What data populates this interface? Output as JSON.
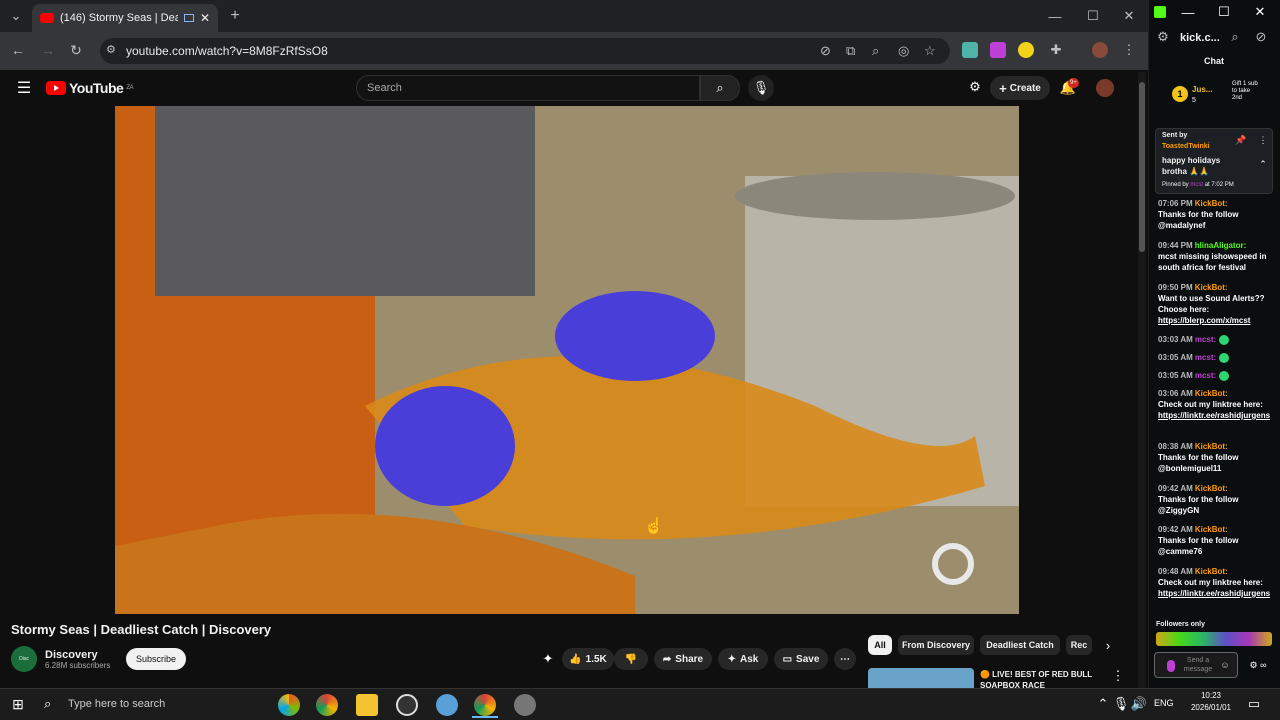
{
  "browser": {
    "tab_title": "(146) Stormy Seas | Deadlie",
    "url": "youtube.com/watch?v=8M8FzRfSsO8"
  },
  "youtube": {
    "logo": "YouTube",
    "country": "ZA",
    "search_placeholder": "Search",
    "create_label": "Create",
    "notif_count": "9+"
  },
  "video": {
    "title": "Stormy Seas | Deadliest Catch | Discovery",
    "channel": "Discovery",
    "subscribers": "6.28M subscribers",
    "subscribe": "Subscribe",
    "likes": "1.5K",
    "share": "Share",
    "ask": "Ask",
    "save": "Save"
  },
  "chips": [
    "All",
    "From Discovery",
    "Deadliest Catch",
    "Rec"
  ],
  "rec": {
    "title": "🟠 LIVE! BEST OF RED BULL SOAPBOX RACE"
  },
  "taskbar": {
    "search": "Type here to search",
    "lang": "ENG",
    "time": "10:23",
    "date": "2026/01/01"
  },
  "chat": {
    "tab_title": "kick.c...",
    "header": "Chat",
    "top_user": "Jus...",
    "top_count": "5",
    "gift_text": "Gift 1 sub to take 2nd",
    "pinned_sent_by": "Sent by",
    "pinned_user": "ToastedTwinki",
    "pinned_text": "happy holidays brotha 🙏🙏",
    "pinned_by": "Pinned by",
    "pinned_by_user": "mcst",
    "pinned_at": "at 7:02 PM",
    "followers_only": "Followers only",
    "send_placeholder": "Send a message",
    "messages": [
      {
        "t": "07:06 PM",
        "u": "KickBot:",
        "m": "Thanks for the follow @madalynef"
      },
      {
        "t": "09:44 PM",
        "u": "hlinaAligator:",
        "m": "mcst missing ishowspeed in south africa for festival"
      },
      {
        "t": "09:50 PM",
        "u": "KickBot:",
        "m": "Want to use Sound Alerts?? Choose here:",
        "l": "https://blerp.com/x/mcst"
      },
      {
        "t": "03:03 AM",
        "u": "mcst:",
        "m": ""
      },
      {
        "t": "03:05 AM",
        "u": "mcst:",
        "m": ""
      },
      {
        "t": "03:05 AM",
        "u": "mcst:",
        "m": ""
      },
      {
        "t": "03:06 AM",
        "u": "KickBot:",
        "m": "Check out my linktree here:",
        "l": "https://linktr.ee/rashidjurgens"
      },
      {
        "t": "08:38 AM",
        "u": "KickBot:",
        "m": "Thanks for the follow @bonlemiguel11"
      },
      {
        "t": "09:42 AM",
        "u": "KickBot:",
        "m": "Thanks for the follow @ZiggyGN"
      },
      {
        "t": "09:42 AM",
        "u": "KickBot:",
        "m": "Thanks for the follow @camme76"
      },
      {
        "t": "09:48 AM",
        "u": "KickBot:",
        "m": "Check out my linktree here:",
        "l": "https://linktr.ee/rashidjurgens"
      }
    ]
  }
}
